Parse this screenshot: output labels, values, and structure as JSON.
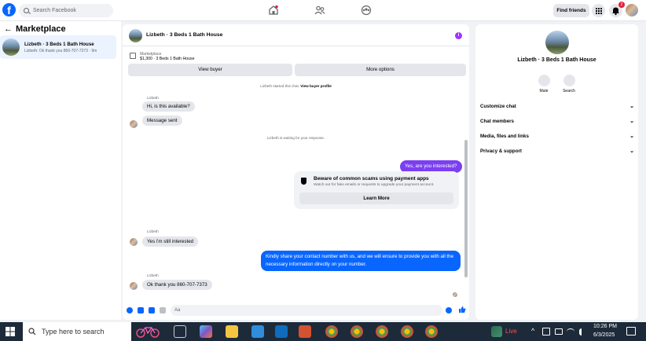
{
  "colors": {
    "accent": "#0866ff",
    "purple": "#7b3ff2",
    "badge": "#e41e3f"
  },
  "topbar": {
    "search_placeholder": "Search Facebook",
    "find_friends": "Find friends",
    "notification_count": "2",
    "logo": "f",
    "icons": [
      "home-icon",
      "friends-icon",
      "groups-icon",
      "menu-grid-icon",
      "bell-icon"
    ]
  },
  "sidebar": {
    "back_arrow": "←",
    "title": "Marketplace",
    "conversation": {
      "title": "Lizbeth · 3 Beds 1 Bath House",
      "preview": "Lizbeth: Ok thank you 860-707-7373 · 9m"
    }
  },
  "chat": {
    "header_title": "Lizbeth · 3 Beds 1 Bath House",
    "info_glyph": "i",
    "marketplace_label": "Marketplace",
    "listing_line": "$1,300 · 3 Beds 1 Bath House",
    "view_buyer": "View buyer",
    "more_options": "More options",
    "started_prefix": "Lizbeth started this chat.",
    "view_buyer_profile": "View buyer profile",
    "waiting": "Lizbeth is waiting for your response.",
    "messages": [
      {
        "sender": "Lizbeth",
        "text": "Hi, is this available?"
      },
      {
        "sender": "",
        "text": "Message sent"
      },
      {
        "sender": "me",
        "text": "Yes, are you interested?"
      },
      {
        "sender": "Lizbeth",
        "text": "Yes i'm still interested"
      },
      {
        "sender": "me",
        "text": "Kindly share your contact number with us, and we will ensure to provide you with all the necessary information directly on your number."
      },
      {
        "sender": "Lizbeth",
        "text": "Ok thank you 860-707-7373"
      }
    ],
    "scam_warning": {
      "title": "Beware of common scams using payment apps",
      "subtitle": "Watch out for fake emails or requests to upgrade your payment account.",
      "button": "Learn More"
    },
    "composer_placeholder": "Aa"
  },
  "details": {
    "title": "Lizbeth · 3 Beds 1 Bath House",
    "mute": "Mute",
    "search": "Search",
    "sections": [
      "Customize chat",
      "Chat members",
      "Media, files and links",
      "Privacy & support"
    ],
    "chevron": "⌄"
  },
  "taskbar": {
    "search_placeholder": "Type here to search",
    "live_label": "Live",
    "time": "10:26 PM",
    "date": "6/3/2025"
  }
}
